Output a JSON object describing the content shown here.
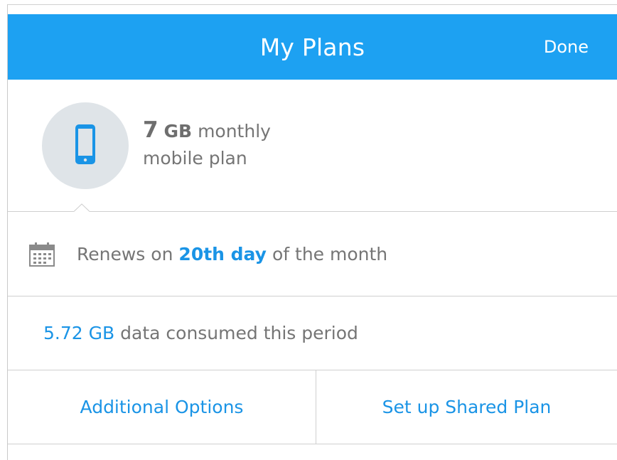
{
  "header": {
    "title": "My Plans",
    "done_label": "Done"
  },
  "plan": {
    "icon": "phone-icon",
    "amount": "7",
    "unit": "GB",
    "line1_rest": "monthly",
    "line2": "mobile plan"
  },
  "renewal": {
    "icon": "calendar-icon",
    "prefix": "Renews on",
    "highlight": "20th day",
    "suffix": "of the month"
  },
  "usage": {
    "amount": "5.72 GB",
    "text": "data consumed this period"
  },
  "actions": {
    "additional_options_label": "Additional Options",
    "shared_plan_label": "Set up Shared Plan"
  },
  "colors": {
    "accent": "#1da1f2",
    "link": "#1a94e6",
    "text": "#757575",
    "avatar_bg": "#dfe4e8"
  }
}
